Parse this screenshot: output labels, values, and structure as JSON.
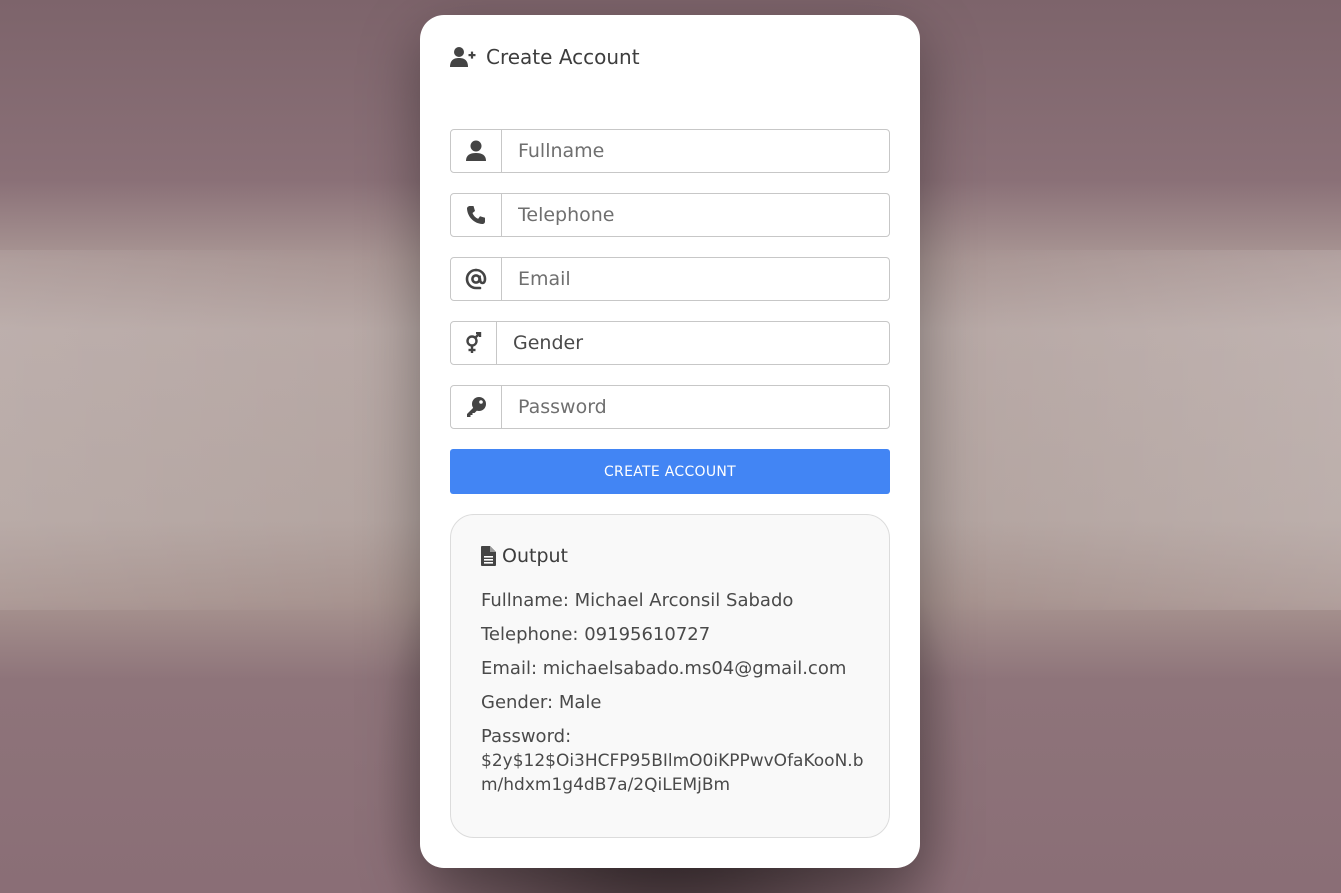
{
  "form": {
    "title": "Create Account",
    "fields": {
      "fullname": {
        "placeholder": "Fullname"
      },
      "telephone": {
        "placeholder": "Telephone"
      },
      "email": {
        "placeholder": "Email"
      },
      "gender": {
        "value": "Gender"
      },
      "password": {
        "placeholder": "Password"
      }
    },
    "submit_label": "CREATE ACCOUNT",
    "submit_color": "#4285f4"
  },
  "output": {
    "title": "Output",
    "fullname_label": "Fullname:",
    "fullname_value": "Michael Arconsil Sabado",
    "telephone_label": "Telephone:",
    "telephone_value": "09195610727",
    "email_label": "Email:",
    "email_value": "michaelsabado.ms04@gmail.com",
    "gender_label": "Gender:",
    "gender_value": "Male",
    "password_label": "Password:",
    "password_value": "$2y$12$Oi3HCFP95BIlmO0iKPPwvOfaKooN.bm/hdxm1g4dB7a/2QiLEMjBm"
  },
  "icons": {
    "header": "user-plus-icon",
    "fullname": "user-icon",
    "telephone": "phone-icon",
    "email": "at-icon",
    "gender": "genderless-icon",
    "password": "key-icon",
    "output": "file-icon"
  }
}
